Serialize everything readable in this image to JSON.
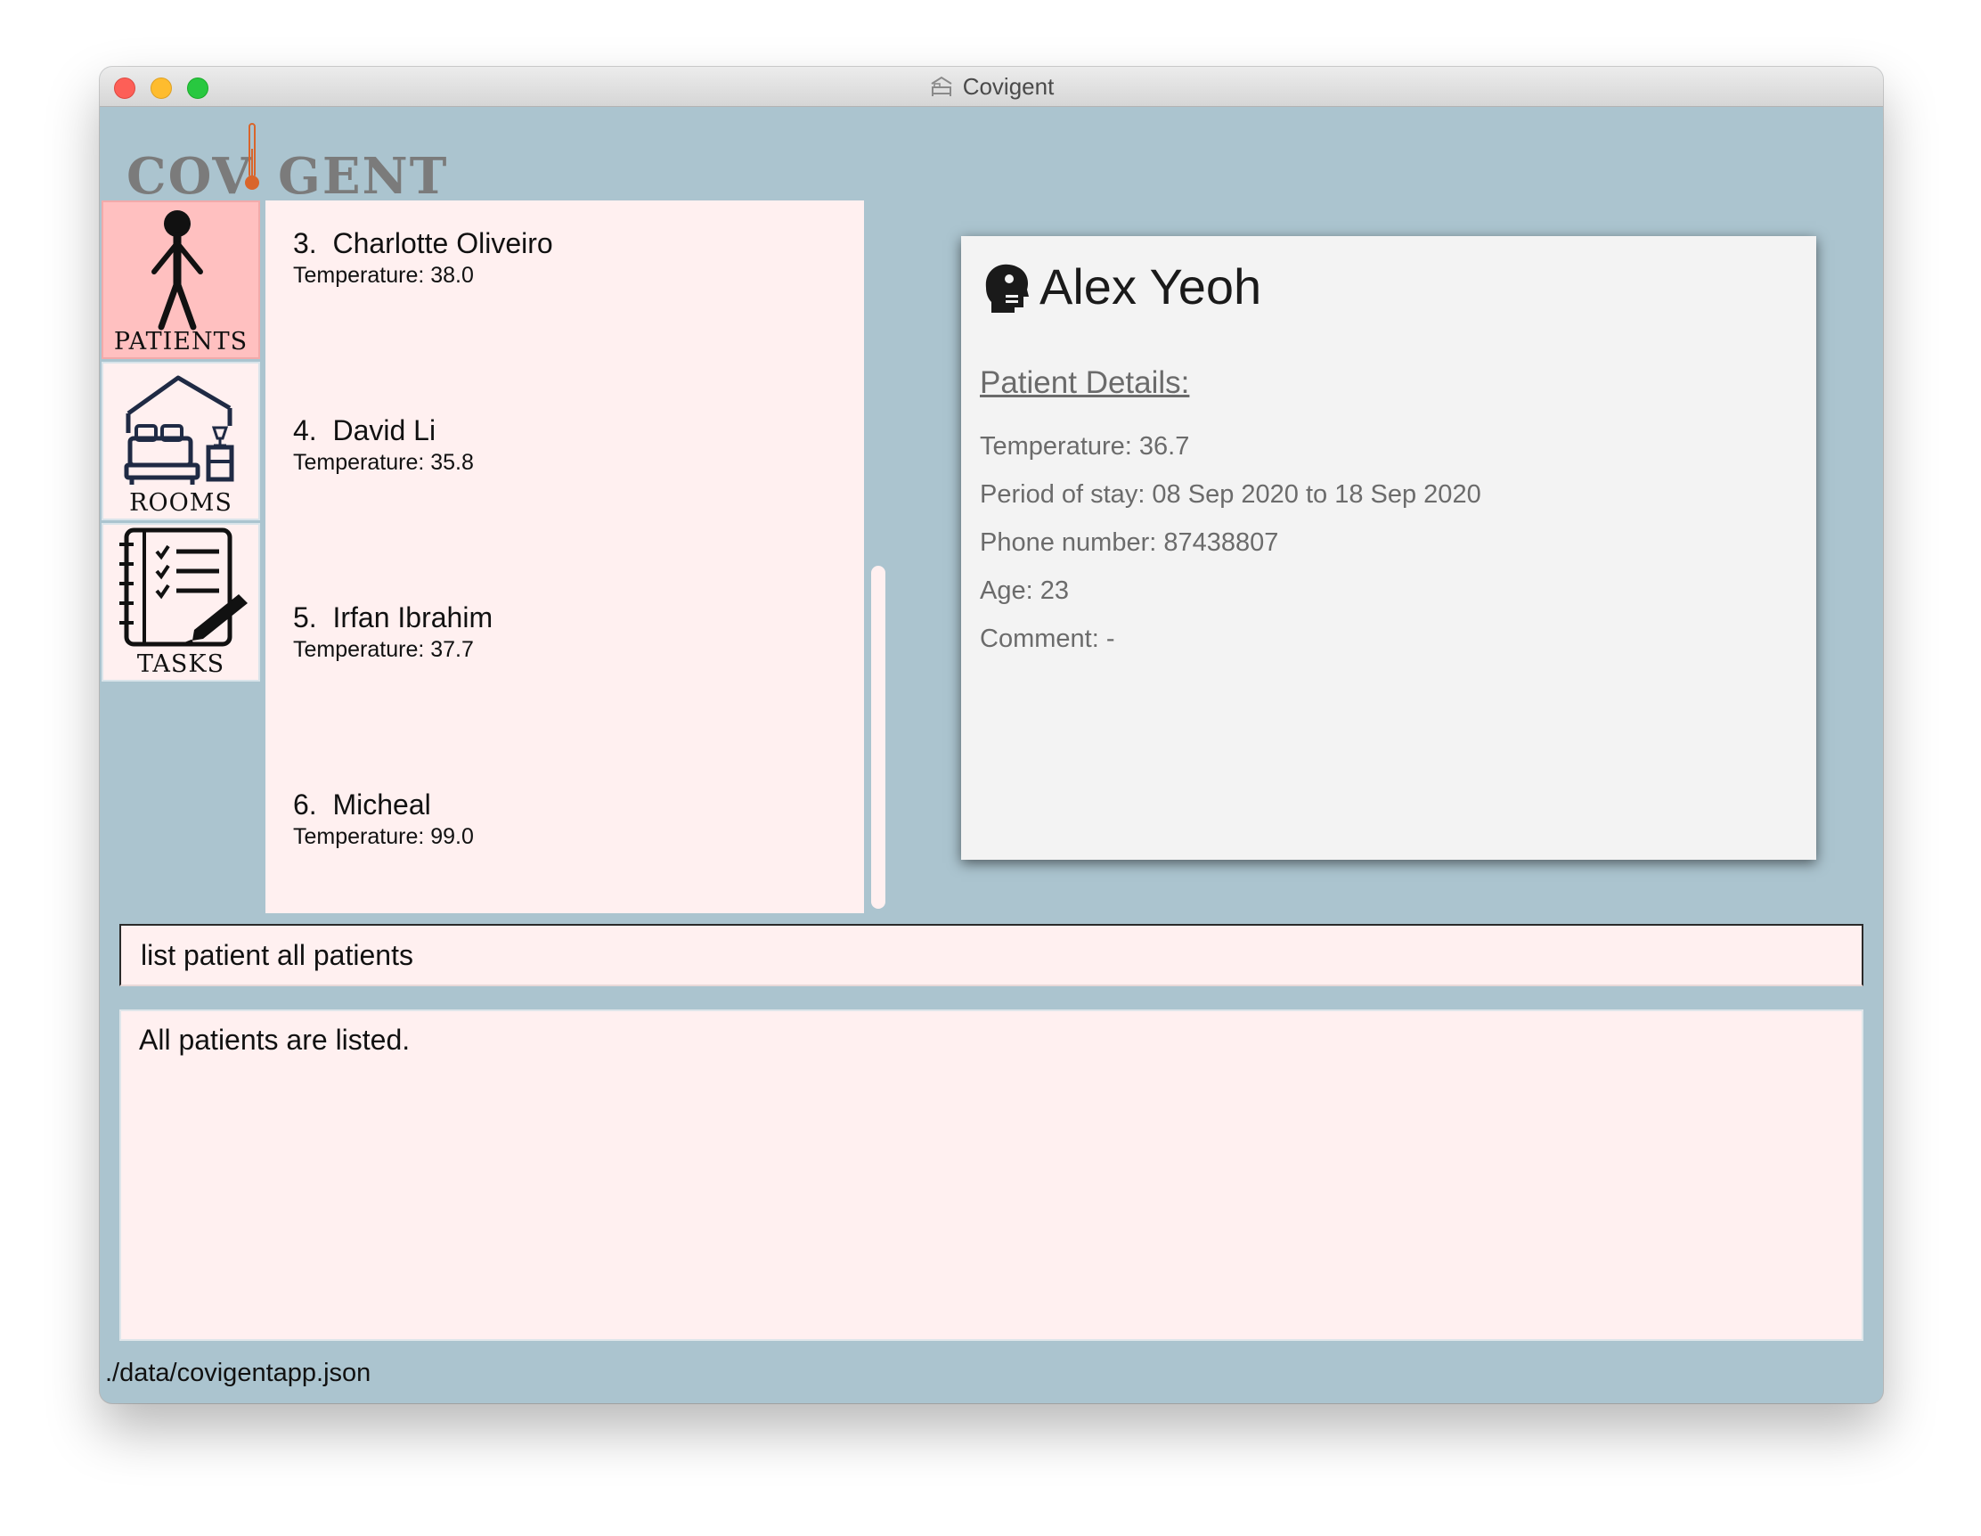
{
  "window": {
    "title": "Covigent",
    "title_icon": "hotel-bed-icon"
  },
  "logo": {
    "text": "COVIGENT",
    "icon": "thermometer-icon",
    "color": "#7b7b7b",
    "accent": "#d9652b"
  },
  "sidebar": {
    "items": [
      {
        "label": "PATIENTS",
        "icon": "person-icon",
        "active": true
      },
      {
        "label": "ROOMS",
        "icon": "bedroom-icon",
        "active": false
      },
      {
        "label": "TASKS",
        "icon": "checklist-icon",
        "active": false
      }
    ]
  },
  "patients": [
    {
      "index": "3.",
      "name": "Charlotte Oliveiro",
      "temperature": "Temperature: 38.0"
    },
    {
      "index": "4.",
      "name": "David Li",
      "temperature": "Temperature: 35.8"
    },
    {
      "index": "5.",
      "name": "Irfan Ibrahim",
      "temperature": "Temperature: 37.7"
    },
    {
      "index": "6.",
      "name": "Micheal",
      "temperature": "Temperature: 99.0"
    }
  ],
  "detail": {
    "icon": "patient-head-icon",
    "name": "Alex Yeoh",
    "heading": "Patient Details:",
    "temperature": "Temperature: 36.7",
    "period": "Period of stay: 08 Sep 2020 to 18 Sep 2020",
    "phone": "Phone number: 87438807",
    "age": "Age: 23",
    "comment": "Comment: -"
  },
  "command": {
    "value": "list patient all patients"
  },
  "result": {
    "text": "All patients are listed."
  },
  "status": {
    "path": "./data/covigentapp.json"
  },
  "colors": {
    "background": "#abc4cf",
    "panel": "#fff0f0",
    "active_tab": "#ffc0c0",
    "detail_card": "#f3f3f3"
  }
}
